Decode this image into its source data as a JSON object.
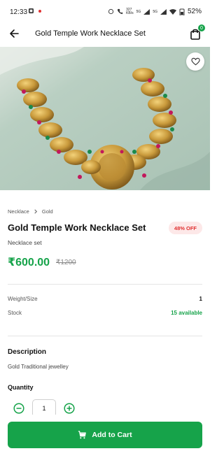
{
  "status_bar": {
    "time": "12:33",
    "net1_top": "327",
    "net1_bottom": "KB/s",
    "net2": "5G",
    "net3": "5G",
    "battery": "52%"
  },
  "app_bar": {
    "title": "Gold Temple Work Necklace Set",
    "cart_count": "0"
  },
  "breadcrumb": {
    "items": [
      "Necklace",
      "Gold"
    ]
  },
  "product": {
    "title": "Gold Temple Work Necklace Set",
    "discount": "48% OFF",
    "subtitle": "Necklace set",
    "price": "₹600.00",
    "mrp": "₹1200"
  },
  "specs": [
    {
      "label": "Weight/Size",
      "value": "1"
    },
    {
      "label": "Stock",
      "value": "15 available"
    }
  ],
  "description": {
    "title": "Description",
    "text": "Gold Traditional jewelley"
  },
  "quantity": {
    "title": "Quantity",
    "value": "1"
  },
  "cta": {
    "label": "Add to Cart"
  },
  "colors": {
    "accent": "#16a34a",
    "discount_bg": "#fde8e8",
    "discount_text": "#e03131"
  },
  "icons": [
    "back-arrow-icon",
    "shopping-bag-icon",
    "heart-icon",
    "chevron-right-icon",
    "minus-circle-icon",
    "plus-circle-icon",
    "cart-icon"
  ]
}
